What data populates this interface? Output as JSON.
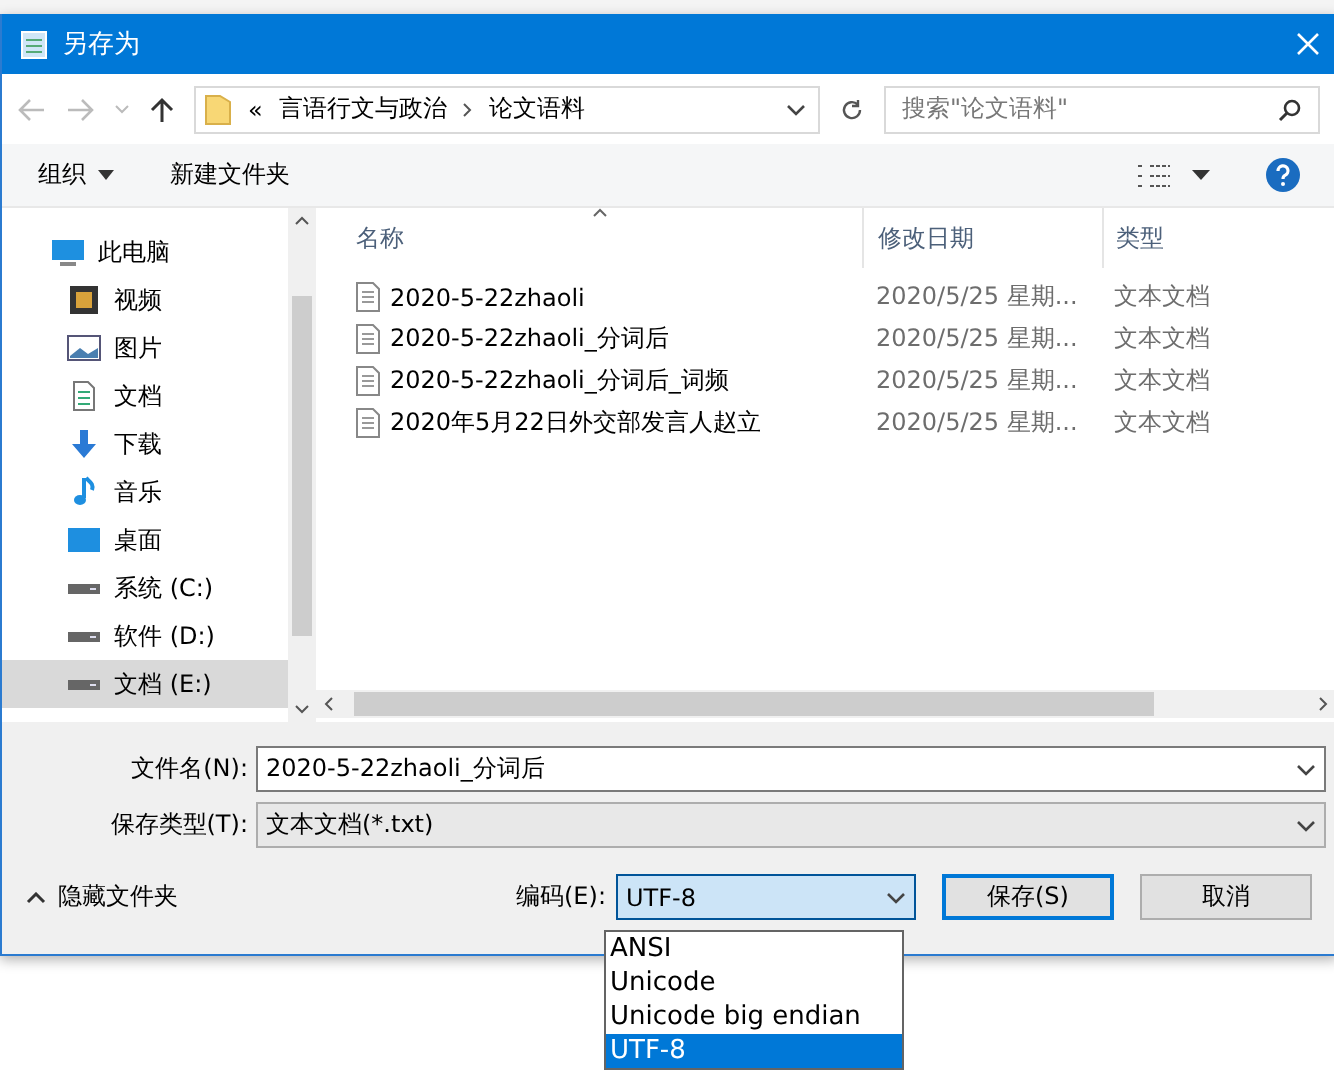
{
  "window": {
    "title": "另存为"
  },
  "address": {
    "path": [
      "言语行文与政治",
      "论文语料"
    ],
    "overflow": "«",
    "search_placeholder": "搜索\"论文语料\""
  },
  "toolbar": {
    "organize": "组织",
    "new_folder": "新建文件夹"
  },
  "nav": [
    {
      "label": "此电脑",
      "selected": false,
      "children": [
        {
          "label": "视频",
          "selected": false
        },
        {
          "label": "图片",
          "selected": false
        },
        {
          "label": "文档",
          "selected": false
        },
        {
          "label": "下载",
          "selected": false
        },
        {
          "label": "音乐",
          "selected": false
        },
        {
          "label": "桌面",
          "selected": false
        },
        {
          "label": "系统 (C:)",
          "selected": false
        },
        {
          "label": "软件 (D:)",
          "selected": false
        },
        {
          "label": "文档 (E:)",
          "selected": true
        }
      ]
    }
  ],
  "columns": [
    "名称",
    "修改日期",
    "类型"
  ],
  "files": [
    {
      "name": "2020-5-22zhaoli",
      "date": "2020/5/25 星期...",
      "type": "文本文档"
    },
    {
      "name": "2020-5-22zhaoli_分词后",
      "date": "2020/5/25 星期...",
      "type": "文本文档"
    },
    {
      "name": "2020-5-22zhaoli_分词后_词频",
      "date": "2020/5/25 星期...",
      "type": "文本文档"
    },
    {
      "name": "2020年5月22日外交部发言人赵立",
      "date": "2020/5/25 星期...",
      "type": "文本文档"
    }
  ],
  "filename": {
    "label": "文件名(N):",
    "value": "2020-5-22zhaoli_分词后"
  },
  "filetype": {
    "label": "保存类型(T):",
    "value": "文本文档(*.txt)"
  },
  "hide_folders": "隐藏文件夹",
  "encoding": {
    "label": "编码(E):",
    "value": "UTF-8",
    "expanded": true,
    "options": [
      {
        "label": "ANSI",
        "selected": false
      },
      {
        "label": "Unicode",
        "selected": false
      },
      {
        "label": "Unicode big endian",
        "selected": false
      },
      {
        "label": "UTF-8",
        "selected": true
      }
    ]
  },
  "buttons": [
    {
      "label": "保存(S)",
      "default": true
    },
    {
      "label": "取消",
      "default": false
    }
  ]
}
